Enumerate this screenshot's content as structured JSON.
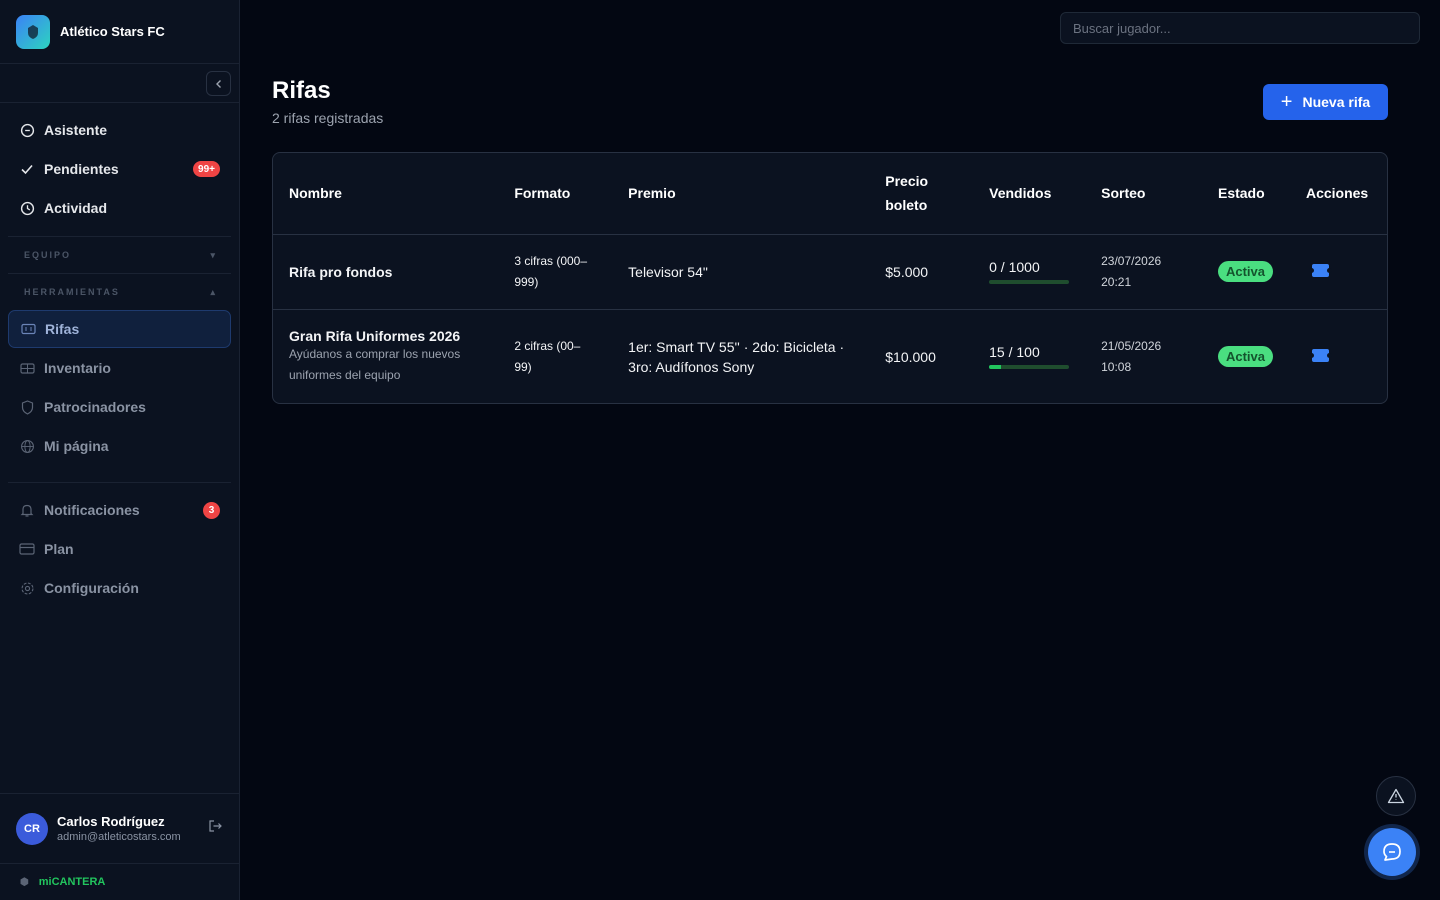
{
  "brand": {
    "name": "Atlético Stars FC"
  },
  "sidebar": {
    "items_top": [
      {
        "label": "Asistente",
        "icon": "chat-icon"
      },
      {
        "label": "Pendientes",
        "icon": "check-icon",
        "badge": "99+"
      },
      {
        "label": "Actividad",
        "icon": "clock-icon"
      }
    ],
    "section_equipo": "EQUIPO",
    "section_herramientas": "HERRAMIENTAS",
    "items_tools": [
      {
        "label": "Rifas",
        "icon": "ticket-icon",
        "active": true
      },
      {
        "label": "Inventario",
        "icon": "box-icon"
      },
      {
        "label": "Patrocinadores",
        "icon": "shield-icon"
      },
      {
        "label": "Mi página",
        "icon": "globe-icon"
      }
    ],
    "items_bottom": [
      {
        "label": "Notificaciones",
        "icon": "bell-icon",
        "badge": "3"
      },
      {
        "label": "Plan",
        "icon": "card-icon"
      },
      {
        "label": "Configuración",
        "icon": "gear-icon"
      }
    ],
    "user": {
      "initials": "CR",
      "name": "Carlos Rodríguez",
      "email": "admin@atleticostars.com"
    },
    "footer": "miCANTERA"
  },
  "search": {
    "placeholder": "Buscar jugador..."
  },
  "header": {
    "title": "Rifas",
    "subtitle": "2 rifas registradas",
    "new_button": "Nueva rifa"
  },
  "table": {
    "columns": [
      "Nombre",
      "Formato",
      "Premio",
      "Precio boleto",
      "Vendidos",
      "Sorteo",
      "Estado",
      "Acciones"
    ],
    "rows": [
      {
        "name": "Rifa pro fondos",
        "description": "",
        "format": "3 cifras (000–999)",
        "prize": "Televisor 54\"",
        "price": "$5.000",
        "sold": "0 / 1000",
        "sold_fraction": 0,
        "draw": "23/07/2026 20:21",
        "status": "Activa"
      },
      {
        "name": "Gran Rifa Uniformes 2026",
        "description": "Ayúdanos a comprar los nuevos uniformes del equipo",
        "format": "2 cifras (00–99)",
        "prize": "1er: Smart TV 55'' · 2do: Bicicleta · 3ro: Audífonos Sony",
        "price": "$10.000",
        "sold": "15 / 100",
        "sold_fraction": 0.15,
        "draw": "21/05/2026 10:08",
        "status": "Activa"
      }
    ]
  },
  "colors": {
    "accent": "#2563eb",
    "status_active": "#4ade80",
    "badge": "#ef4444",
    "background": "#030712"
  }
}
